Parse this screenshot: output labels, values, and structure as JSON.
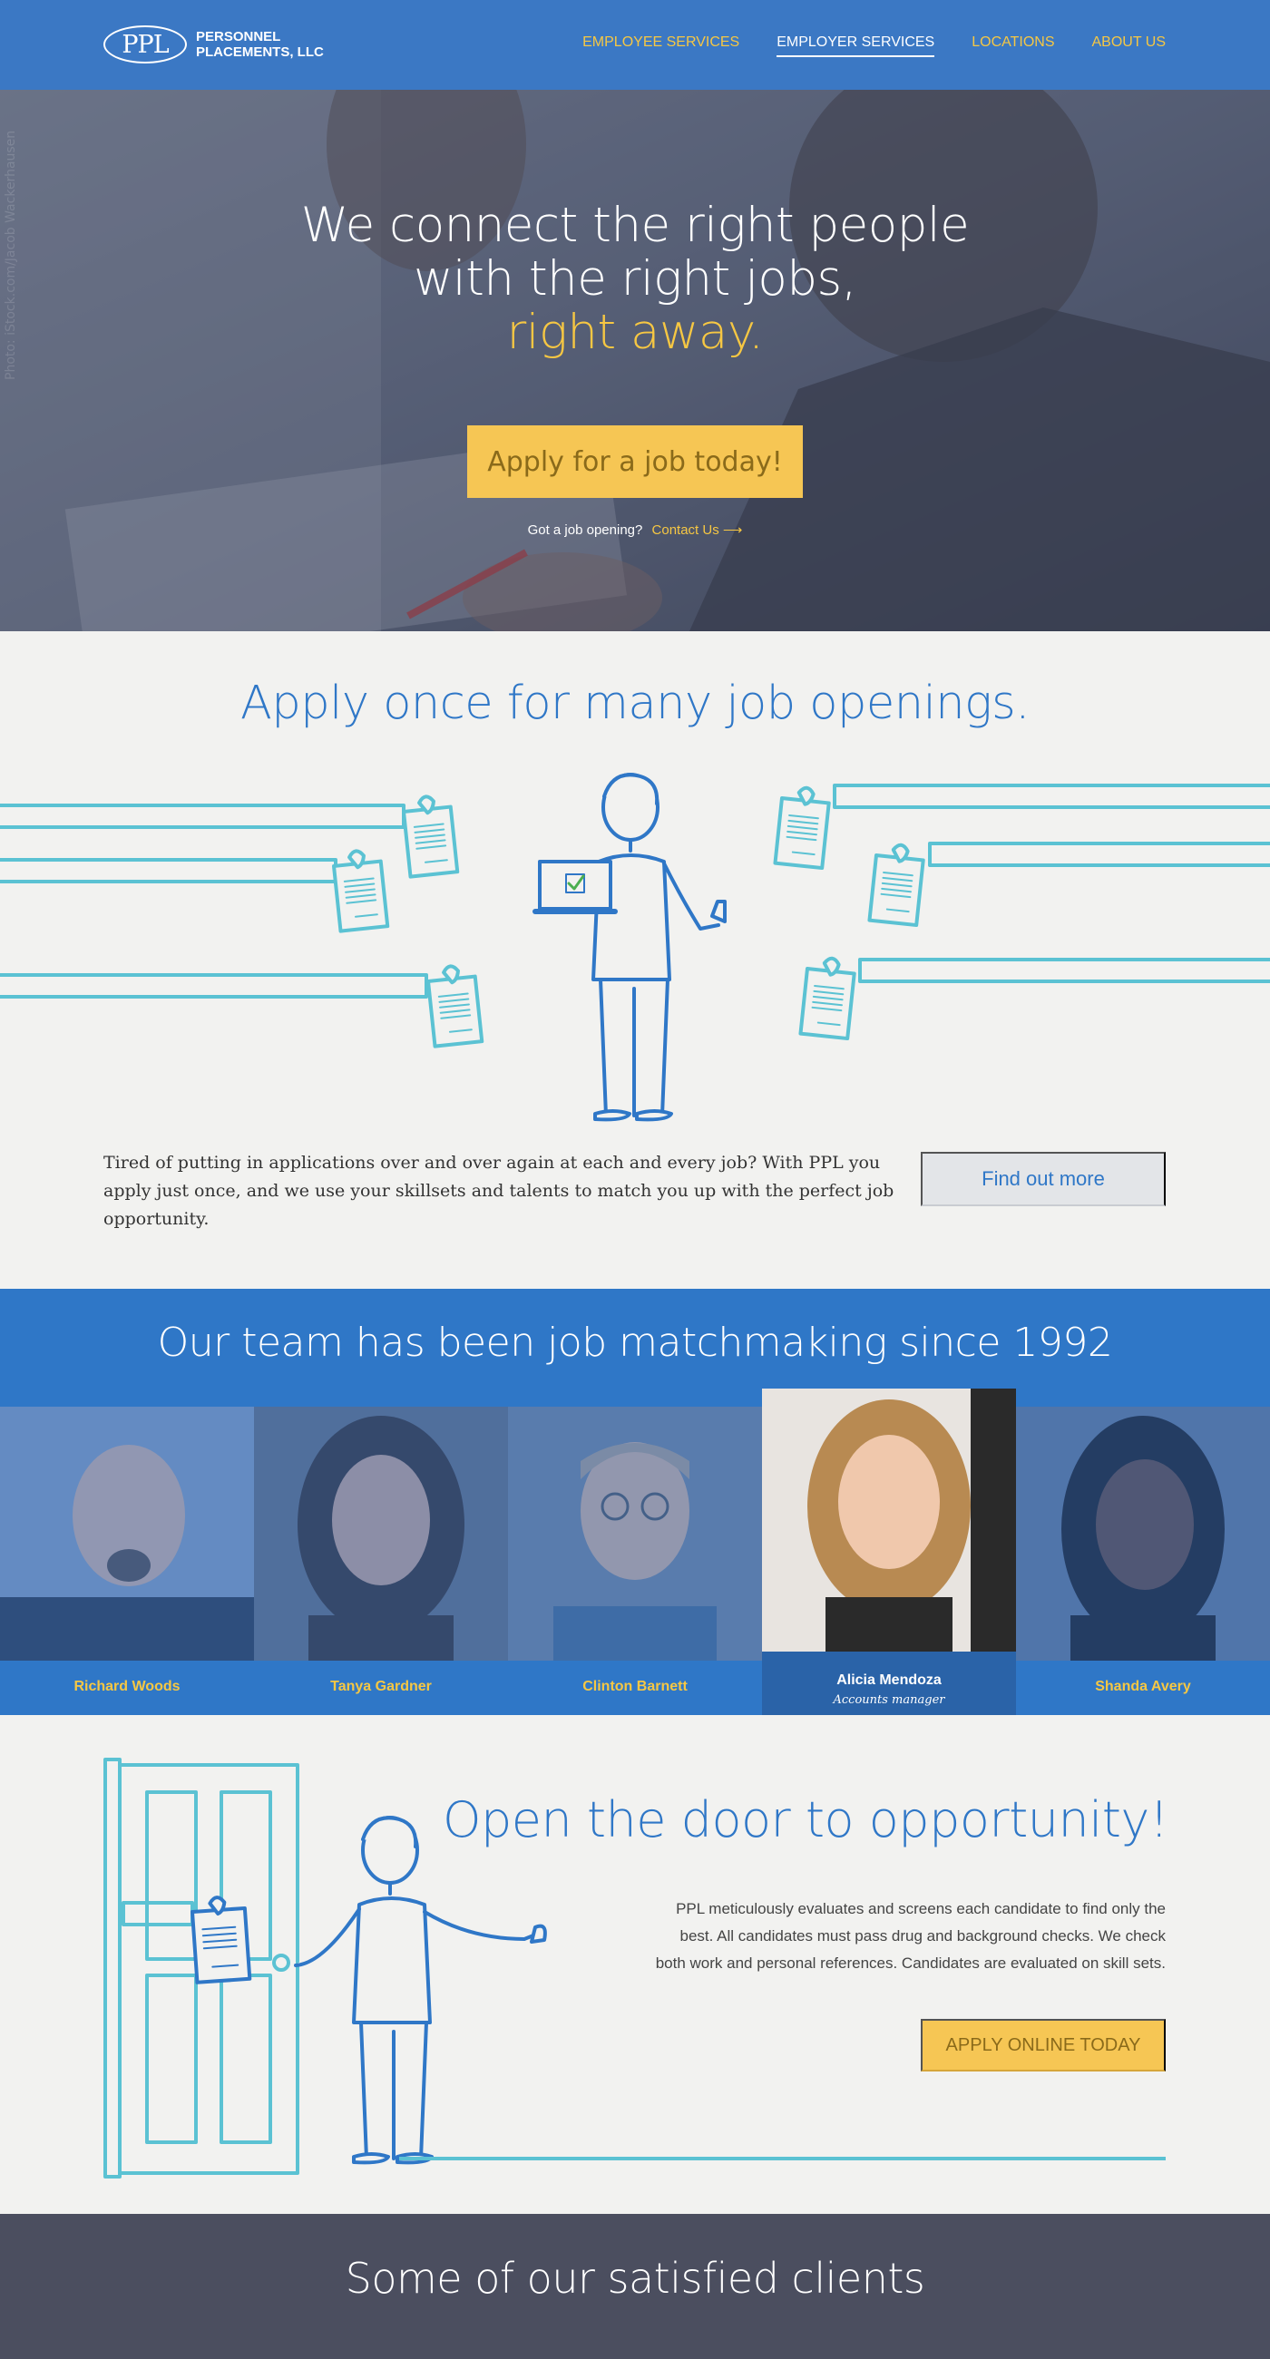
{
  "nav": {
    "logo_mark": "PPL",
    "logo_line1": "PERSONNEL",
    "logo_line2": "PLACEMENTS, LLC",
    "links": [
      "EMPLOYEE SERVICES",
      "EMPLOYER SERVICES",
      "LOCATIONS",
      "ABOUT US"
    ],
    "active_index": 1
  },
  "hero": {
    "line1": "We connect the right people",
    "line2": "with the right jobs,",
    "accent": "right away.",
    "button": "Apply for a job today!",
    "sub_text": "Got a job opening?",
    "sub_link": "Contact Us ⟶",
    "watermark": "Photo: iStock.com/Jacob Wackerhausen"
  },
  "apply": {
    "title": "Apply once for many job openings.",
    "text": "Tired of putting in applications over and over again at each and every job? With PPL you apply just once, and we use your skillsets and talents to match you up with the perfect job opportunity.",
    "button": "Find out more"
  },
  "team": {
    "title": "Our team has been job matchmaking since 1992",
    "members": [
      {
        "name": "Richard Woods"
      },
      {
        "name": "Tanya Gardner"
      },
      {
        "name": "Clinton Barnett"
      },
      {
        "name": "Alicia Mendoza",
        "role": "Accounts manager"
      },
      {
        "name": "Shanda Avery"
      }
    ]
  },
  "door": {
    "title": "Open the door to opportunity!",
    "text": "PPL meticulously evaluates and screens each candidate to find only the best. All candidates must pass drug and background checks. We check both work and personal references. Candidates are evaluated on skill sets.",
    "button": "APPLY ONLINE TODAY"
  },
  "clients": {
    "title": "Some of our satisfied clients"
  },
  "colors": {
    "brand_blue": "#2f77c7",
    "nav_blue": "#3b78c4",
    "accent_yellow": "#f6c654",
    "teal": "#5bc2d3",
    "dark": "#4b4e5f"
  }
}
